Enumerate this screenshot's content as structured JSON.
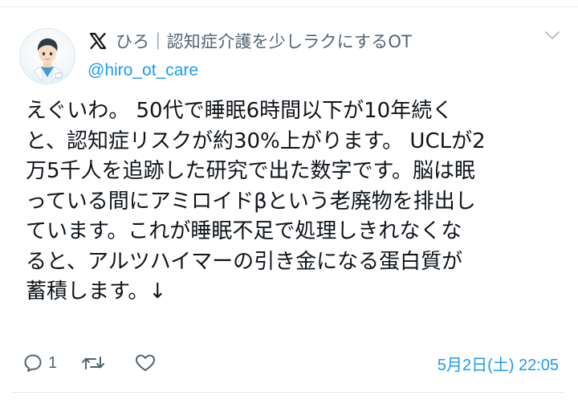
{
  "author": {
    "display_name": "ひろ｜認知症介護を少しラクにするOT",
    "handle": "@hiro_ot_care"
  },
  "tweet": {
    "lines": [
      "えぐいわ。 50代で睡眠6時間以下が10年続く",
      "と、認知症リスクが約30%上がります。 UCLが2",
      "万5千人を追跡した研究で出た数字です。脳は眠",
      "っている間にアミロイドβという老廃物を排出し",
      "ています。これが睡眠不足で処理しきれなくな",
      "ると、アルツハイマーの引き金になる蛋白質が",
      "蓄積します。↓"
    ],
    "reply_count": "1",
    "timestamp": "5月2日(土) 22:05"
  },
  "icons": {
    "logo": "x-logo-icon",
    "menu": "chevron-down-icon",
    "reply": "reply-icon",
    "retweet": "retweet-icon",
    "like": "heart-icon"
  },
  "colors": {
    "text": "#0f1419",
    "muted": "#536471",
    "link": "#1d9bf0",
    "divider": "#e6e9ec"
  }
}
